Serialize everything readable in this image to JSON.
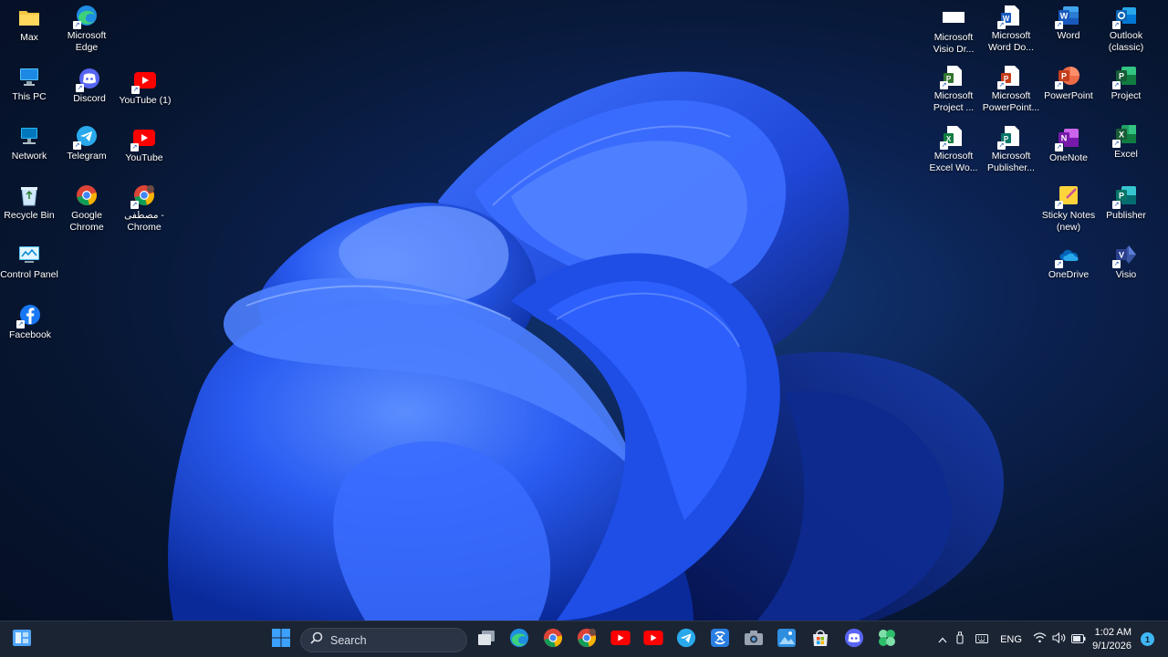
{
  "desktop": {
    "left_icons": [
      {
        "name": "folder-icon",
        "label": "Max"
      },
      {
        "name": "edge-icon",
        "label": "Microsoft\nEdge"
      },
      {
        "name": "this-pc-icon",
        "label": "This PC"
      },
      {
        "name": "discord-icon",
        "label": "Discord"
      },
      {
        "name": "youtube-icon",
        "label": "YouTube (1)"
      },
      {
        "name": "network-icon",
        "label": "Network"
      },
      {
        "name": "telegram-icon",
        "label": "Telegram"
      },
      {
        "name": "youtube-icon",
        "label": "YouTube"
      },
      {
        "name": "recycle-bin-icon",
        "label": "Recycle Bin"
      },
      {
        "name": "chrome-icon",
        "label": "Google\nChrome"
      },
      {
        "name": "chrome-profile-icon",
        "label": "مصطفى -\nChrome"
      },
      {
        "name": "control-panel-icon",
        "label": "Control Panel"
      },
      {
        "name": "facebook-icon",
        "label": "Facebook"
      }
    ],
    "right_icons": [
      {
        "name": "visio-drawing-icon",
        "label": "Microsoft\nVisio Dr..."
      },
      {
        "name": "word-document-icon",
        "label": "Microsoft\nWord Do..."
      },
      {
        "name": "word-icon",
        "label": "Word"
      },
      {
        "name": "outlook-icon",
        "label": "Outlook\n(classic)"
      },
      {
        "name": "project-file-icon",
        "label": "Microsoft\nProject ..."
      },
      {
        "name": "powerpoint-file-icon",
        "label": "Microsoft\nPowerPoint..."
      },
      {
        "name": "powerpoint-icon",
        "label": "PowerPoint"
      },
      {
        "name": "project-icon",
        "label": "Project"
      },
      {
        "name": "excel-file-icon",
        "label": "Microsoft\nExcel Wo..."
      },
      {
        "name": "publisher-file-icon",
        "label": "Microsoft\nPublisher..."
      },
      {
        "name": "onenote-icon",
        "label": "OneNote"
      },
      {
        "name": "excel-icon",
        "label": "Excel"
      },
      {
        "name": "sticky-notes-icon",
        "label": "Sticky Notes\n(new)"
      },
      {
        "name": "publisher-icon",
        "label": "Publisher"
      },
      {
        "name": "onedrive-icon",
        "label": "OneDrive"
      },
      {
        "name": "visio-icon",
        "label": "Visio"
      }
    ]
  },
  "taskbar": {
    "search_label": "Search",
    "apps": [
      "windows-start-icon",
      "search-icon",
      "task-view-icon",
      "edge-icon",
      "chrome-icon",
      "chrome-profile-icon",
      "youtube-icon",
      "youtube-icon",
      "telegram-icon",
      "snipping-tool-icon",
      "camera-icon",
      "photos-icon",
      "microsoft-store-icon",
      "discord-icon",
      "clipchamp-icon"
    ],
    "tray": {
      "language": "ENG",
      "time": "1:02 AM",
      "date": "9/1/2026",
      "notification_count": "1"
    }
  },
  "colors": {
    "accent": "#2f6bff",
    "taskbar_bg": "#1b2433",
    "wallpaper_bg": "#071631"
  }
}
